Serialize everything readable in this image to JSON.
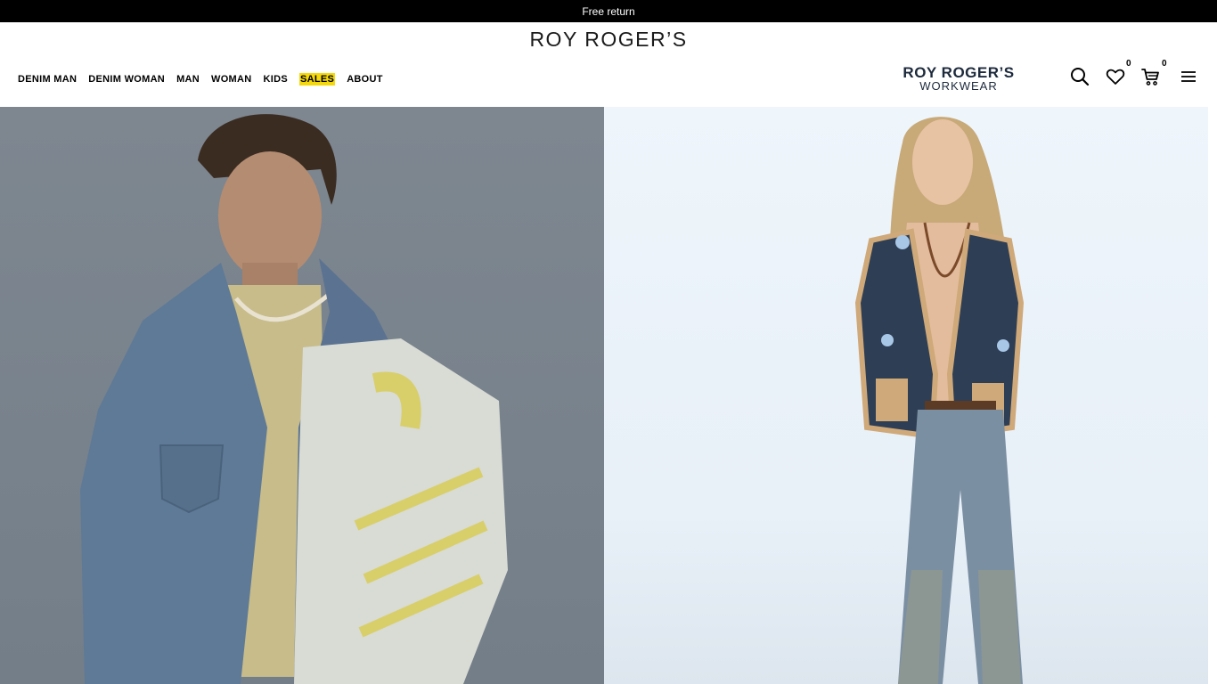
{
  "topbar": {
    "text": "Free return"
  },
  "header": {
    "logo": "ROY ROGER’S",
    "nav": [
      {
        "label": "DENIM MAN"
      },
      {
        "label": "DENIM WOMAN"
      },
      {
        "label": "MAN"
      },
      {
        "label": "WOMAN"
      },
      {
        "label": "KIDS"
      },
      {
        "label": "SALES",
        "highlight": true
      },
      {
        "label": "ABOUT"
      }
    ],
    "workwear_logo": {
      "line1": "ROY ROGER’S",
      "line2": "WORKWEAR"
    },
    "wishlist_count": "0",
    "cart_count": "0",
    "icons": [
      "search-icon",
      "heart-icon",
      "cart-icon",
      "menu-icon"
    ]
  },
  "hero": {
    "panels": [
      {
        "name": "man-denim-jacket-photo",
        "background": "#7b848e"
      },
      {
        "name": "woman-denim-vest-photo",
        "background": "#ebf2f9"
      }
    ]
  },
  "colors": {
    "topbar": "#000000",
    "sales_highlight": "#f5d90a",
    "workwear_text": "#1d2a3c"
  }
}
